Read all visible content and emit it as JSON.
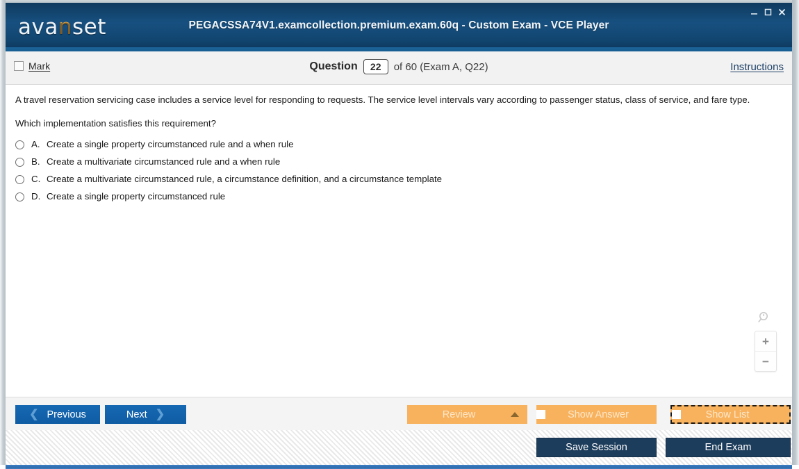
{
  "window": {
    "title": "PEGACSSA74V1.examcollection.premium.exam.60q - Custom Exam - VCE Player",
    "logo_prefix": "ava",
    "logo_accent": "n",
    "logo_suffix": "set",
    "controls": {
      "minimize": "minimize-icon",
      "maximize": "maximize-icon",
      "close": "close-icon"
    },
    "colors": {
      "titlebar": "#14456f",
      "accent_blue": "#1d6398",
      "logo_accent": "#f0a32a",
      "primary_button": "#1164ae",
      "orange_button": "#f8b25e",
      "dark_button": "#1d3d5c"
    }
  },
  "header": {
    "mark_label": "Mark",
    "mark_checked": false,
    "question_word": "Question",
    "question_number": "22",
    "of_text": "of 60 (Exam A, Q22)",
    "instructions_label": "Instructions"
  },
  "question": {
    "stem_line_1": "A travel reservation servicing case includes a service level for responding to requests. The service level intervals vary according to passenger status, class of service, and fare type.",
    "stem_line_2": "Which implementation satisfies this requirement?",
    "options": [
      {
        "letter": "A.",
        "text": "Create a single property circumstanced rule and a when rule",
        "selected": false
      },
      {
        "letter": "B.",
        "text": "Create a multivariate circumstanced rule and a when rule",
        "selected": false
      },
      {
        "letter": "C.",
        "text": "Create a multivariate circumstanced rule, a circumstance definition, and a circumstance template",
        "selected": false
      },
      {
        "letter": "D.",
        "text": "Create a single property circumstanced rule",
        "selected": false
      }
    ]
  },
  "zoom_widget": {
    "magnifier_icon": "magnifier-icon",
    "zoom_in": "+",
    "zoom_out": "−"
  },
  "actions": {
    "previous": "Previous",
    "next": "Next",
    "review": "Review",
    "show_answer": "Show Answer",
    "show_list": "Show List"
  },
  "footer": {
    "save_session": "Save Session",
    "end_exam": "End Exam"
  }
}
